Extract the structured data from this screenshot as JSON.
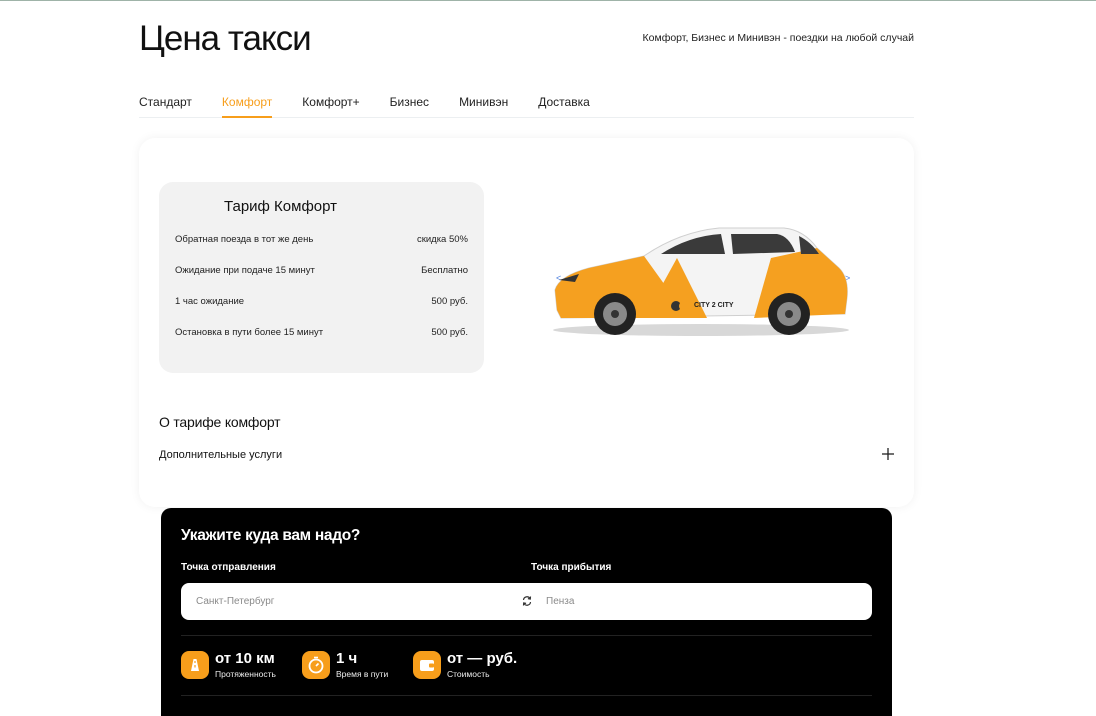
{
  "header": {
    "title": "Цена такси",
    "tagline": "Комфорт, Бизнес и Минивэн - поездки на любой случай"
  },
  "tabs": [
    {
      "label": "Стандарт",
      "active": false
    },
    {
      "label": "Комфорт",
      "active": true
    },
    {
      "label": "Комфорт+",
      "active": false
    },
    {
      "label": "Бизнес",
      "active": false
    },
    {
      "label": "Минивэн",
      "active": false
    },
    {
      "label": "Доставка",
      "active": false
    }
  ],
  "tariff": {
    "title": "Тариф Комфорт",
    "rows": [
      {
        "label": "Обратная поезда в тот же день",
        "value": "скидка 50%"
      },
      {
        "label": "Ожидание при подаче 15 минут",
        "value": "Бесплатно"
      },
      {
        "label": "1 час ожидание",
        "value": "500 руб."
      },
      {
        "label": "Остановка в пути более 15 минут",
        "value": "500 руб."
      }
    ]
  },
  "car": {
    "brand_text": "CITY 2 CITY",
    "prev_icon": "chevron-left-icon",
    "next_icon": "chevron-right-icon"
  },
  "about": {
    "title": "О тарифе комфорт",
    "extra_label": "Дополнительные услуги"
  },
  "route": {
    "title": "Укажите куда вам надо?",
    "from_label": "Точка отправления",
    "to_label": "Точка прибытия",
    "from_value": "Санкт-Петербург",
    "to_value": "Пенза",
    "stats": [
      {
        "value": "от 10 км",
        "caption": "Протяженность",
        "icon": "road-icon"
      },
      {
        "value": "1 ч",
        "caption": "Время в пути",
        "icon": "timer-icon"
      },
      {
        "value": "от — руб.",
        "caption": "Стоимость",
        "icon": "wallet-icon"
      }
    ]
  },
  "colors": {
    "accent": "#f79e1b",
    "route_bg": "#000000",
    "tariff_bg": "#f2f2f2"
  }
}
